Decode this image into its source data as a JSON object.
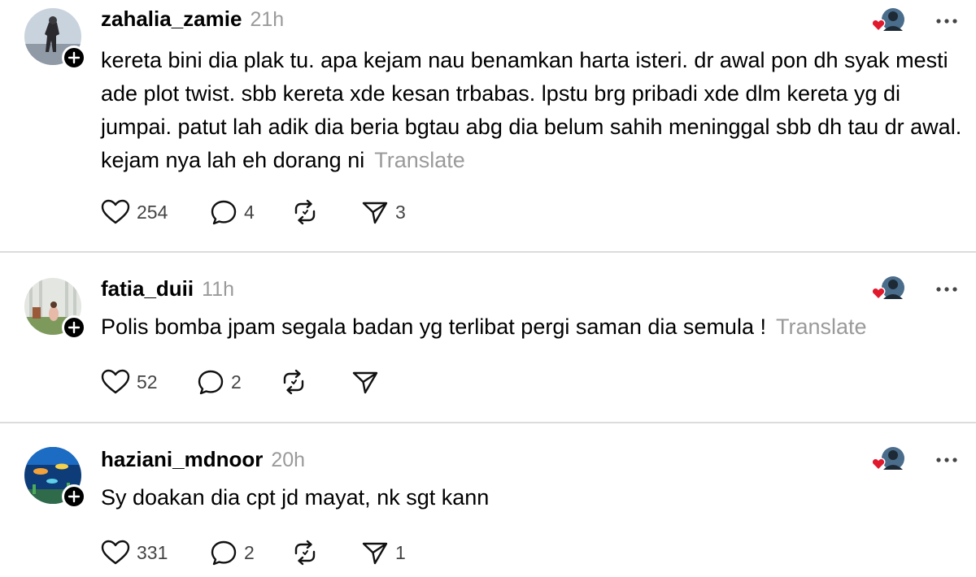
{
  "colors": {
    "text": "#000000",
    "muted": "#9a9a9a",
    "divider": "#dcdcdc",
    "heart": "#e0192d",
    "badge": "#000000"
  },
  "icons": {
    "like": "heart-outline-icon",
    "reply": "speech-bubble-icon",
    "repost": "repost-arrows-icon",
    "share": "paper-plane-icon",
    "more": "more-dots-icon",
    "follow": "plus-badge-icon"
  },
  "posts": [
    {
      "username": "zahalia_zamie",
      "time": "21h",
      "text": "kereta bini dia plak tu. apa kejam nau benamkan harta isteri. dr awal pon dh syak mesti ade plot twist. sbb kereta xde kesan trbabas. lpstu brg pribadi xde dlm kereta yg di jumpai. patut lah adik dia beria bgtau abg dia belum sahih meninggal sbb dh tau dr awal. kejam nya lah eh dorang ni",
      "translate_label": "Translate",
      "likes": "254",
      "replies": "4",
      "reposts": "",
      "shares": "3"
    },
    {
      "username": "fatia_duii",
      "time": "11h",
      "text": "Polis bomba jpam segala badan yg terlibat pergi saman dia semula !",
      "translate_label": "Translate",
      "likes": "52",
      "replies": "2",
      "reposts": "",
      "shares": ""
    },
    {
      "username": "haziani_mdnoor",
      "time": "20h",
      "text": "Sy doakan dia cpt jd mayat, nk sgt kann",
      "translate_label": "",
      "likes": "331",
      "replies": "2",
      "reposts": "",
      "shares": "1"
    }
  ]
}
